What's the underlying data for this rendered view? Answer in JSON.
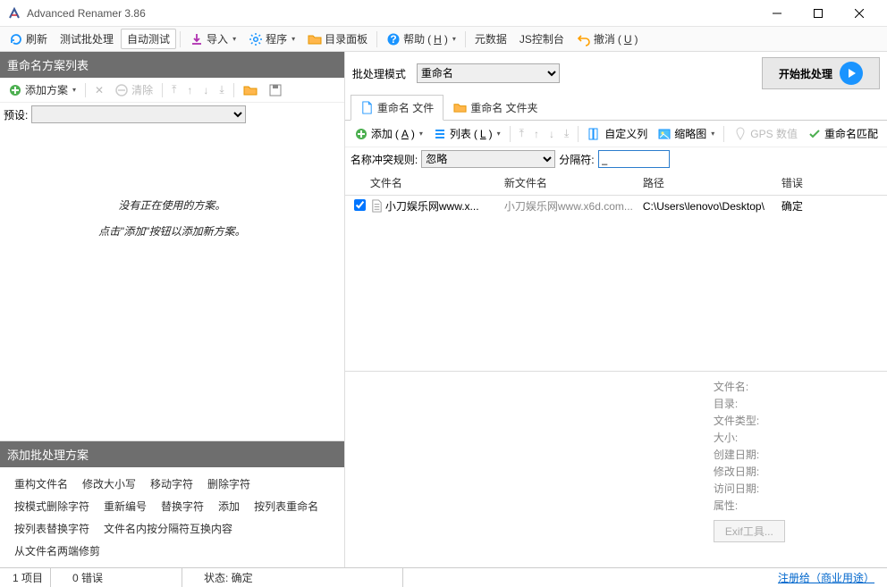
{
  "window": {
    "title": "Advanced Renamer 3.86"
  },
  "toolbar": {
    "refresh": "刷新",
    "test_batch": "测试批处理",
    "auto_test": "自动测试",
    "import": "导入",
    "program": "程序",
    "dir_panel": "目录面板",
    "help": "帮助",
    "metadata": "元数据",
    "js_console": "JS控制台",
    "undo": "撤消",
    "help_hk": "H",
    "undo_hk": "U"
  },
  "left": {
    "header": "重命名方案列表",
    "add_method": "添加方案",
    "clear": "清除",
    "preset_label": "预设:",
    "empty1": "没有正在使用的方案。",
    "empty2": "点击\"添加\"按钮以添加新方案。",
    "add_hdr": "添加批处理方案",
    "methods": [
      "重构文件名",
      "修改大小写",
      "移动字符",
      "删除字符",
      "按模式删除字符",
      "重新编号",
      "替换字符",
      "添加",
      "按列表重命名",
      "按列表替换字符",
      "文件名内按分隔符互换内容",
      "从文件名两端修剪"
    ]
  },
  "right": {
    "mode_label": "批处理模式",
    "mode_value": "重命名",
    "start": "开始批处理",
    "tab_files": "重命名 文件",
    "tab_folders": "重命名 文件夹",
    "add": "添加",
    "add_hk": "A",
    "list": "列表",
    "list_hk": "L",
    "custom_cols": "自定义列",
    "thumbs": "缩略图",
    "gps": "GPS 数值",
    "rename_match": "重命名匹配",
    "conflict_label": "名称冲突规则:",
    "conflict_value": "忽略",
    "delim_label": "分隔符:",
    "delim_value": "_",
    "cols": {
      "filename": "文件名",
      "newname": "新文件名",
      "path": "路径",
      "error": "错误"
    },
    "row": {
      "filename": "小刀娱乐网www.x...",
      "newname": "小刀娱乐网www.x6d.com...",
      "path": "C:\\Users\\lenovo\\Desktop\\",
      "error": "确定"
    },
    "info": {
      "filename": "文件名:",
      "dir": "目录:",
      "type": "文件类型:",
      "size": "大小:",
      "created": "创建日期:",
      "modified": "修改日期:",
      "accessed": "访问日期:",
      "attrs": "属性:",
      "exif": "Exif工具..."
    }
  },
  "status": {
    "items": "1 项目",
    "errors": "0 错误",
    "state": "状态: 确定",
    "register": "注册给（商业用途）"
  }
}
